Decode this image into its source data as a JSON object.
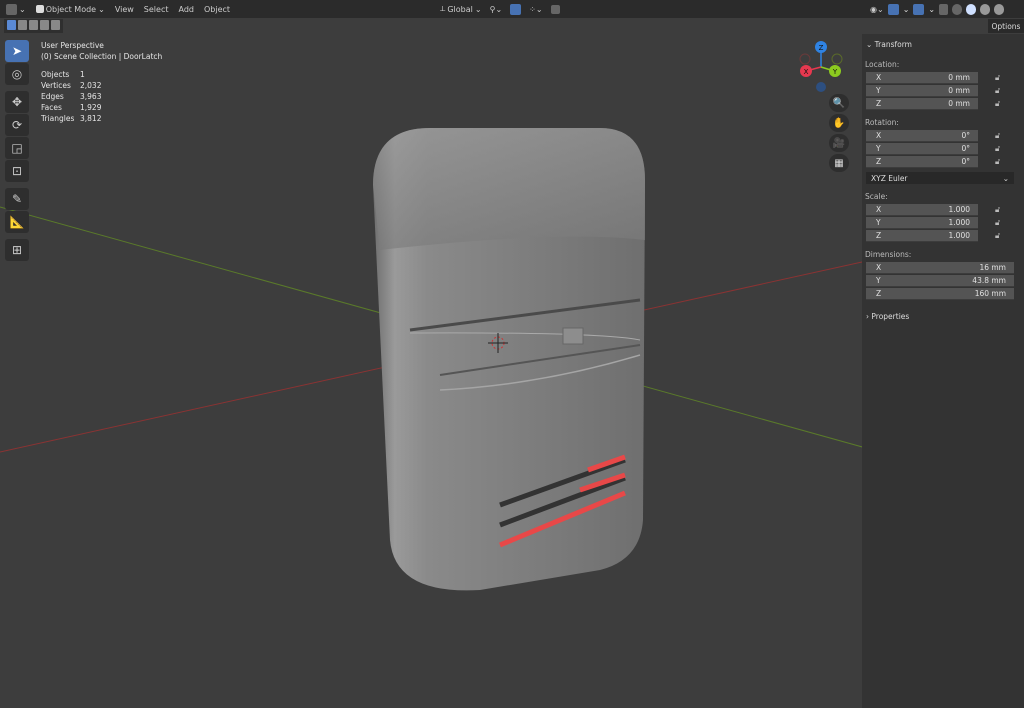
{
  "header": {
    "mode": "Object Mode",
    "menus": [
      "View",
      "Select",
      "Add",
      "Object"
    ],
    "orientation": "Global",
    "options_label": "Options"
  },
  "overlay": {
    "view_name": "User Perspective",
    "collection": "(0) Scene Collection | DoorLatch",
    "stats": [
      {
        "k": "Objects",
        "v": "1"
      },
      {
        "k": "Vertices",
        "v": "2,032"
      },
      {
        "k": "Edges",
        "v": "3,963"
      },
      {
        "k": "Faces",
        "v": "1,929"
      },
      {
        "k": "Triangles",
        "v": "3,812"
      }
    ]
  },
  "gizmo": {
    "x": "X",
    "y": "Y",
    "z": "Z",
    "colors": {
      "x": "#e8384f",
      "y": "#8ccb1f",
      "z": "#2f83e3"
    }
  },
  "panel": {
    "title": "Transform",
    "location_label": "Location:",
    "location": [
      {
        "a": "X",
        "v": "0 mm"
      },
      {
        "a": "Y",
        "v": "0 mm"
      },
      {
        "a": "Z",
        "v": "0 mm"
      }
    ],
    "rotation_label": "Rotation:",
    "rotation": [
      {
        "a": "X",
        "v": "0°"
      },
      {
        "a": "Y",
        "v": "0°"
      },
      {
        "a": "Z",
        "v": "0°"
      }
    ],
    "rotation_mode": "XYZ Euler",
    "scale_label": "Scale:",
    "scale": [
      {
        "a": "X",
        "v": "1.000"
      },
      {
        "a": "Y",
        "v": "1.000"
      },
      {
        "a": "Z",
        "v": "1.000"
      }
    ],
    "dimensions_label": "Dimensions:",
    "dimensions": [
      {
        "a": "X",
        "v": "16 mm"
      },
      {
        "a": "Y",
        "v": "43.8 mm"
      },
      {
        "a": "Z",
        "v": "160 mm"
      }
    ],
    "properties_label": "Properties"
  },
  "colors": {
    "accent": "#4772b3",
    "stripe": "#e84848"
  }
}
